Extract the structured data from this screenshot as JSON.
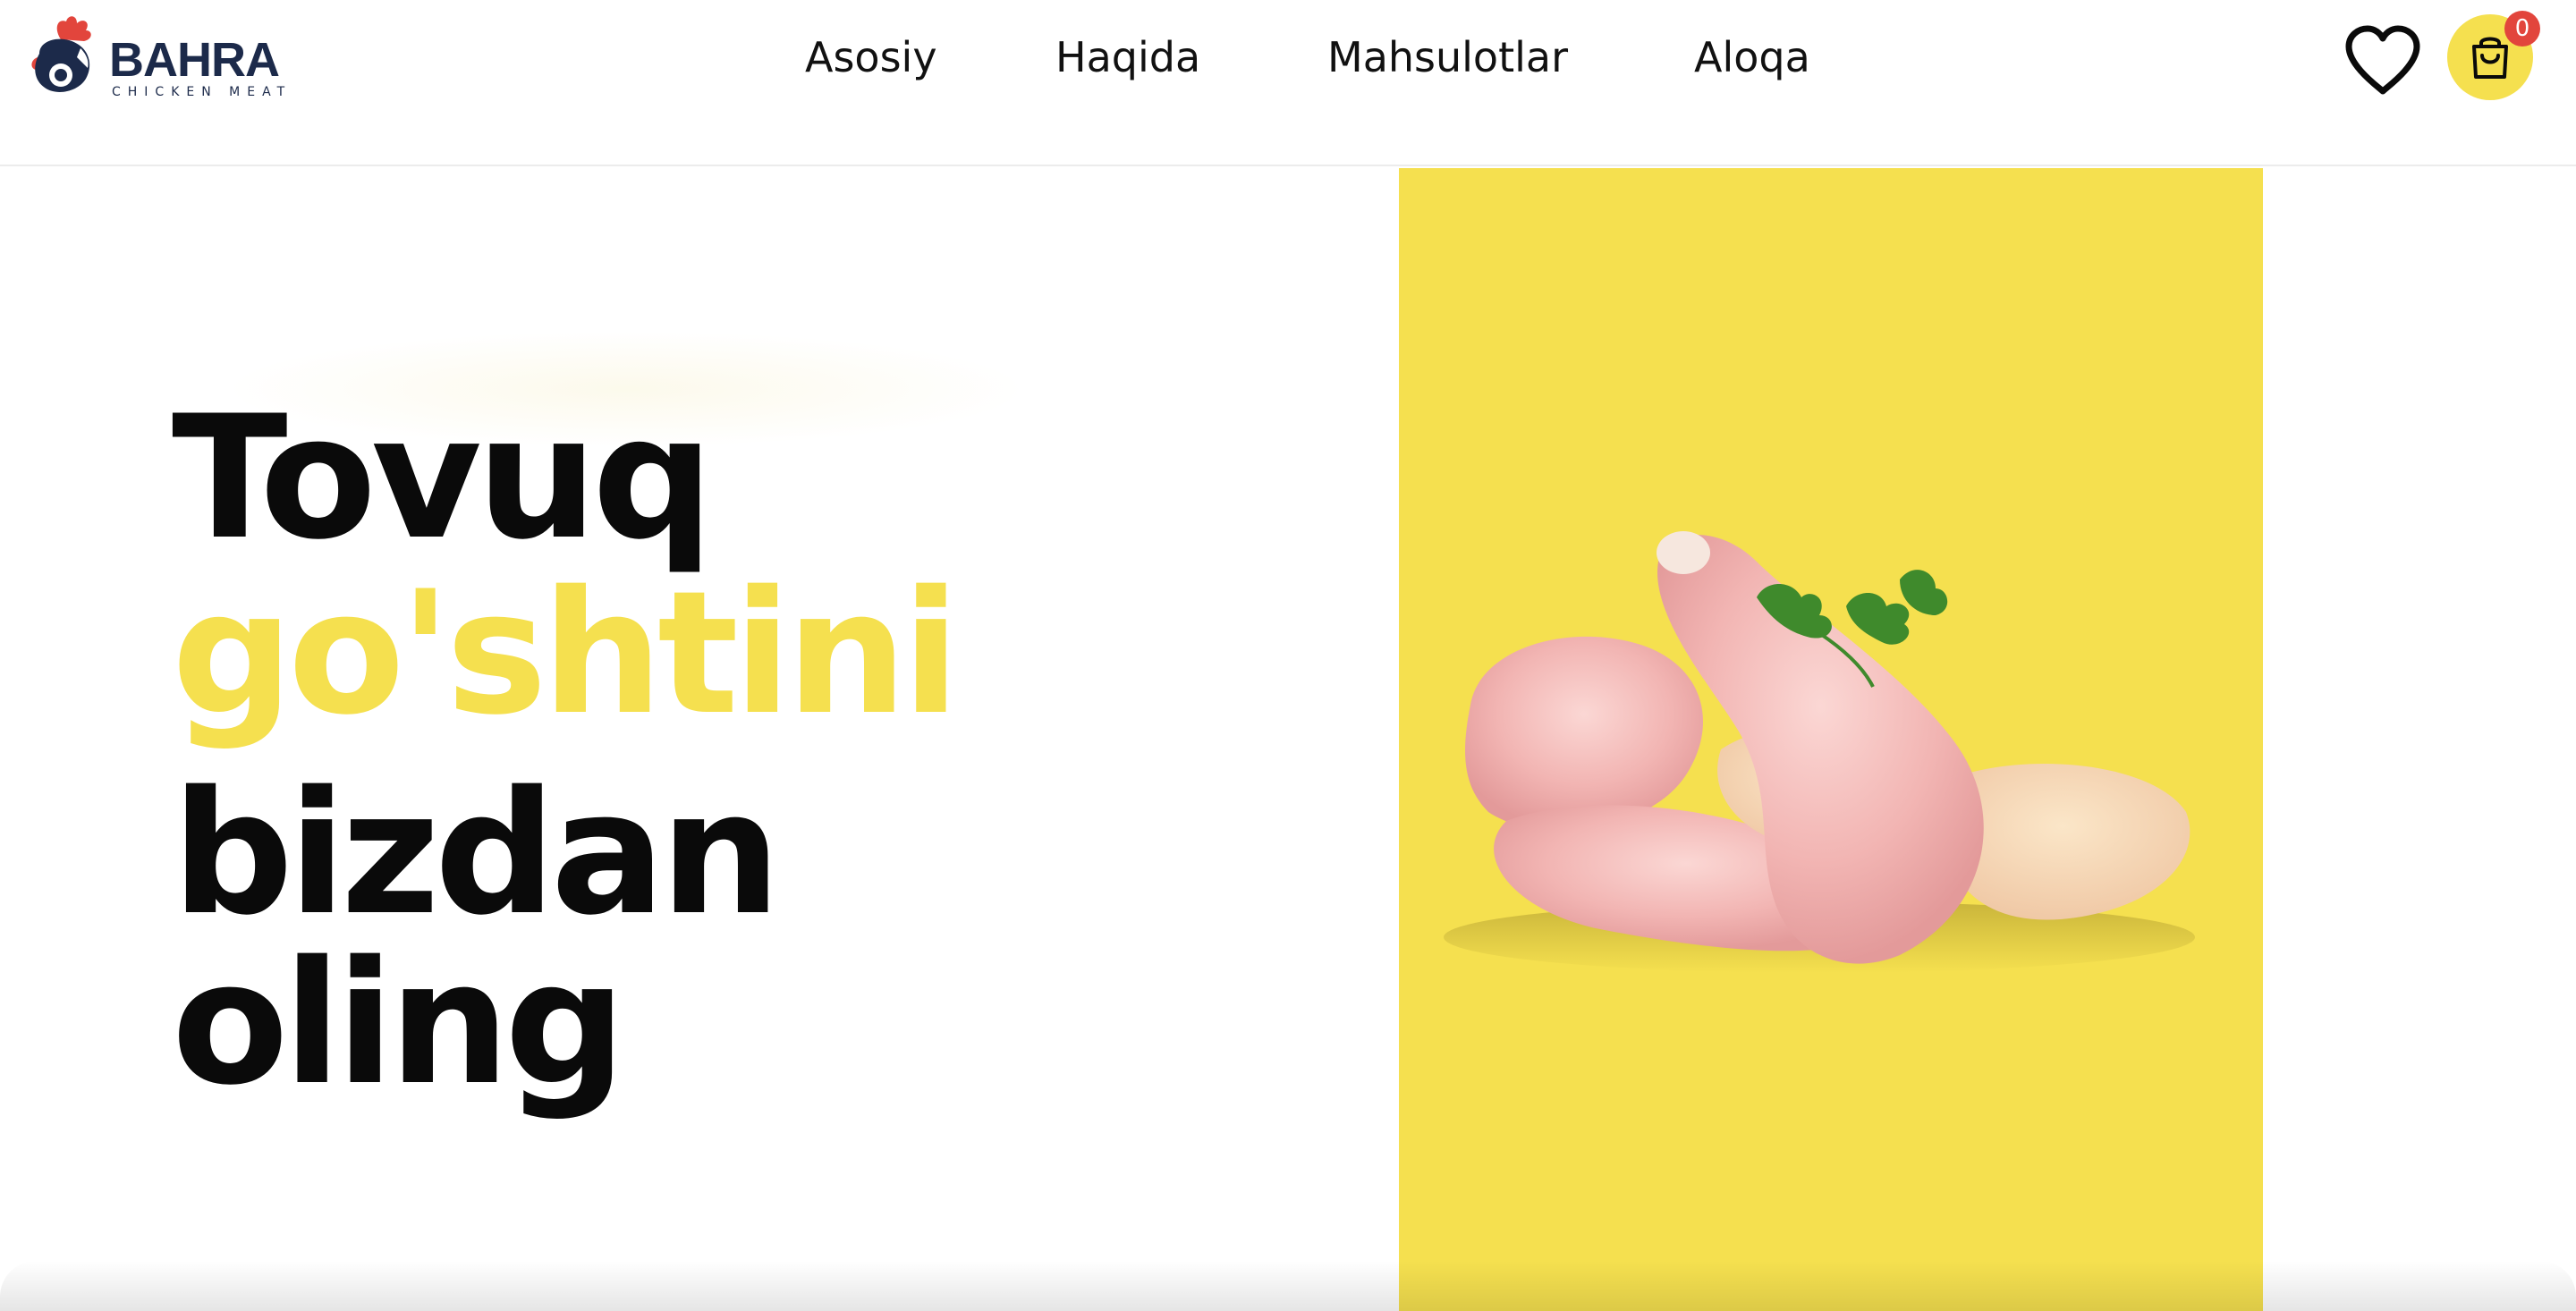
{
  "brand": {
    "name": "BAHRA",
    "tagline": "CHICKEN MEAT"
  },
  "nav": {
    "items": [
      {
        "label": "Asosiy"
      },
      {
        "label": "Haqida"
      },
      {
        "label": "Mahsulotlar"
      },
      {
        "label": "Aloqa"
      }
    ]
  },
  "header": {
    "wishlist_icon": "heart-icon",
    "cart_icon": "shopping-bag-icon",
    "cart_count": "0"
  },
  "hero": {
    "line1": "Tovuq",
    "line2": "go'shtini",
    "line3": "bizdan",
    "line4": "oling",
    "image": "raw chicken drumsticks with parsley"
  },
  "colors": {
    "accent_yellow": "#f5e04f",
    "brand_navy": "#1c2a4a",
    "brand_red": "#e2453c",
    "text_dark": "#0a0a0a"
  }
}
